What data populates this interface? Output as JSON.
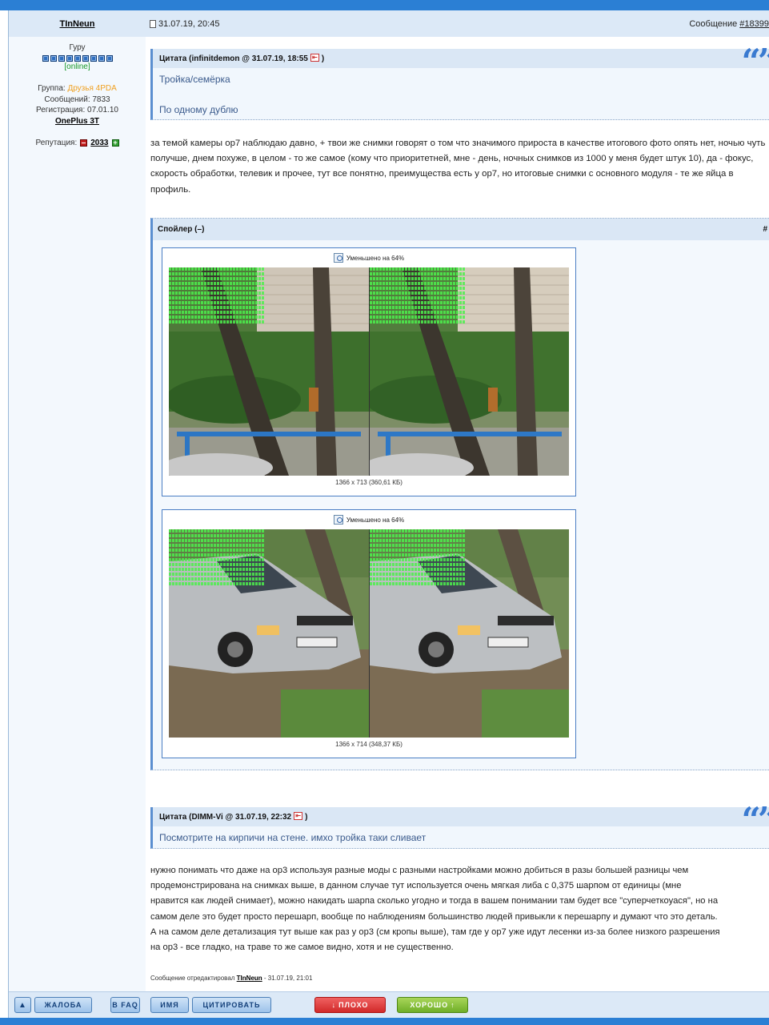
{
  "colors": {
    "header_blue": "#2b7fd4",
    "panel_blue": "#dce9f7",
    "quote_text": "#3a5a8c",
    "online_green": "#1a9a2a",
    "group_orange": "#f0a020"
  },
  "user": {
    "name": "TInNeun",
    "rank_title": "Гуру",
    "rank_boxes": 9,
    "status": "[online]",
    "group_label": "Группа:",
    "group_value": "Друзья 4PDA",
    "messages": "Сообщений: 7833",
    "registered": "Регистрация: 07.01.10",
    "device": "OnePlus 3T",
    "reputation_label": "Репутация:",
    "reputation_value": "2033"
  },
  "post": {
    "date": "31.07.19, 20:45",
    "number_label": "Сообщение",
    "number_link": "#18399"
  },
  "quote1": {
    "header": "Цитата (infinitdemon @ 31.07.19, 18:55",
    "close_paren": ")",
    "line1": "Тройка/семёрка",
    "line2": "По одному дублю"
  },
  "paragraph1": "за темой камеры op7 наблюдаю давно, + твои же снимки говорят о том что значимого прироста в качестве итогового фото опять нет, ночью чуть получше, днем похуже, в целом - то же самое (кому что приоритетней, мне - день, ночных снимков из 1000 у меня будет штук 10), да - фокус, скорость обработки, телевик и прочее, тут все понятно, преимущества есть у op7, но итоговые снимки с основного модуля - те же яйца в профиль.",
  "spoiler": {
    "title": "Спойлер (–)",
    "hash": "#",
    "images": [
      {
        "caption": "Уменьшено на 64%",
        "dims": "1366 x 713 (360,61 КБ)",
        "scene": "trees"
      },
      {
        "caption": "Уменьшено на 64%",
        "dims": "1366 x 714 (348,37 КБ)",
        "scene": "car"
      }
    ]
  },
  "quote2": {
    "header": "Цитата (DIMM-Vi @ 31.07.19, 22:32",
    "close_paren": ")",
    "line1": "Посмотрите на кирпичи на стене. имхо тройка таки сливает"
  },
  "paragraph2_lines": [
    "нужно понимать что даже на op3 используя разные моды с разными настройками можно добиться в разы большей разницы чем",
    "продемонстрирована на снимках выше, в данном случае тут используется очень мягкая либа с 0,375 шарпом от единицы (мне",
    "нравится как людей снимает), можно накидать шарпа сколько угодно и тогда в вашем понимании там будет все \"суперчеткоуася\", но на",
    "самом деле это будет просто перешарп, вообще по наблюдениям большинство людей привыкли к перешарпу и думают что это деталь.",
    "А на самом деле детализация тут выше как раз у op3 (см кропы выше), там где у op7 уже идут лесенки из-за более низкого разрешения",
    "на op3 - все гладко, на траве то же самое видно, хотя и не существенно."
  ],
  "edited": {
    "prefix": "Сообщение отредактировал",
    "user": "TInNeun",
    "suffix": "- 31.07.19, 21:01"
  },
  "toolbar": {
    "up_icon": "arrow-up-icon",
    "complaint": "ЖАЛОБА",
    "faq": "В FAQ",
    "name": "ИМЯ",
    "quote": "ЦИТИРОВАТЬ",
    "bad": "ПЛОХО",
    "good": "ХОРОШО"
  }
}
